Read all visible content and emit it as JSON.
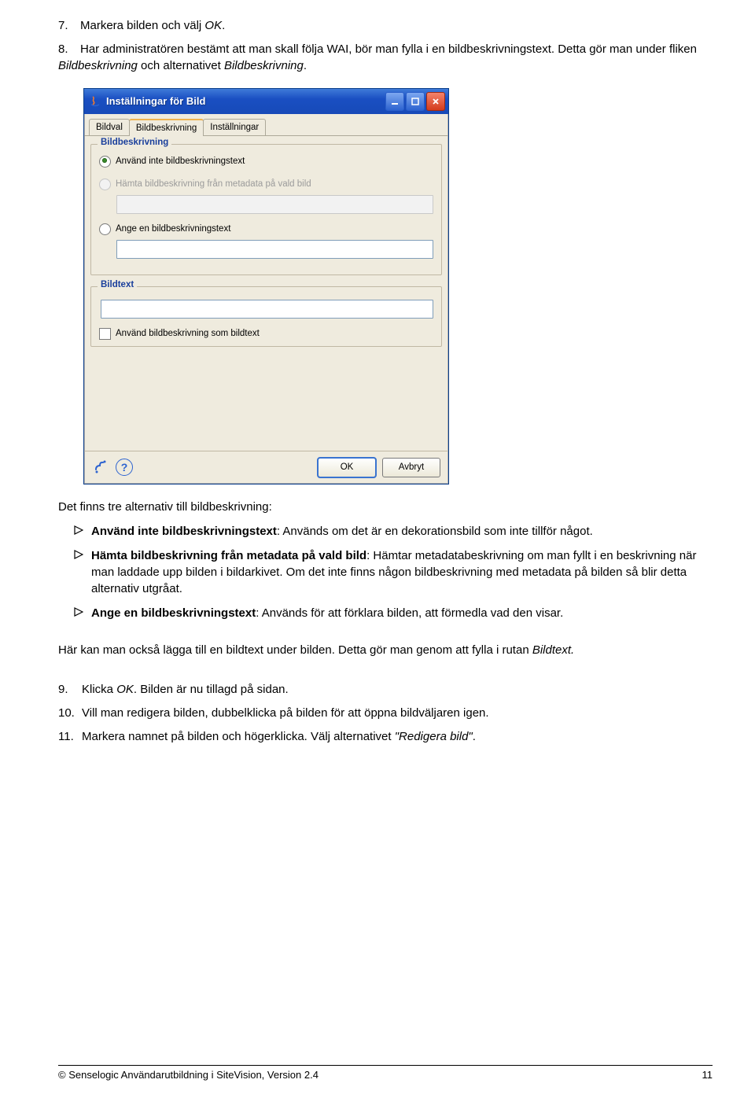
{
  "list7": {
    "num": "7.",
    "text_a": "Markera bilden och välj ",
    "ok": "OK",
    "text_b": "."
  },
  "list8": {
    "num": "8.",
    "text_a": "Har administratören bestämt att man skall följa WAI, bör man fylla i en bildbeskrivningstext. Detta gör man under fliken ",
    "em1": "Bildbeskrivning",
    "mid": " och alternativet ",
    "em2": "Bildbeskrivning",
    "end": "."
  },
  "dialog": {
    "title": "Inställningar för Bild",
    "tabs": {
      "bildval": "Bildval",
      "bildbeskrivning": "Bildbeskrivning",
      "installningar": "Inställningar"
    },
    "group_bildbeskrivning": "Bildbeskrivning",
    "radio1": "Använd inte bildbeskrivningstext",
    "radio2": "Hämta bildbeskrivning från metadata på vald bild",
    "radio3": "Ange en bildbeskrivningstext",
    "group_bildtext": "Bildtext",
    "checkbox": "Använd bildbeskrivning som bildtext",
    "help": "?",
    "ok": "OK",
    "cancel": "Avbryt"
  },
  "para_intro": "Det finns tre alternativ till bildbeskrivning:",
  "bullet1": {
    "bold": "Använd inte bildbeskrivningstext",
    "rest": ": Används om det är en dekorationsbild som inte tillför något."
  },
  "bullet2": {
    "bold": "Hämta bildbeskrivning från metadata på vald bild",
    "rest": ": Hämtar metadatabeskrivning om man fyllt i en beskrivning när man laddade upp bilden i bildarkivet. Om det inte finns någon bildbeskrivning med metadata på bilden så blir detta alternativ utgråat."
  },
  "bullet3": {
    "bold": "Ange en bildbeskrivningstext",
    "rest": ": Används för att förklara bilden, att förmedla vad den visar."
  },
  "para_bildtext_a": "Här kan man också lägga till en bildtext under bilden. Detta gör man genom att fylla i rutan ",
  "para_bildtext_em": "Bildtext.",
  "list9": {
    "num": "9.",
    "text_a": "Klicka ",
    "ok": "OK",
    "text_b": ". Bilden är nu tillagd på sidan."
  },
  "list10": {
    "num": "10.",
    "text": "Vill man redigera bilden, dubbelklicka på bilden för att öppna bildväljaren igen."
  },
  "list11": {
    "num": "11.",
    "text": "Markera namnet på bilden och högerklicka. Välj alternativet ",
    "em": "\"Redigera bild\"",
    "end": "."
  },
  "footer": {
    "left": "© Senselogic Användarutbildning i SiteVision, Version 2.4",
    "right": "11"
  }
}
